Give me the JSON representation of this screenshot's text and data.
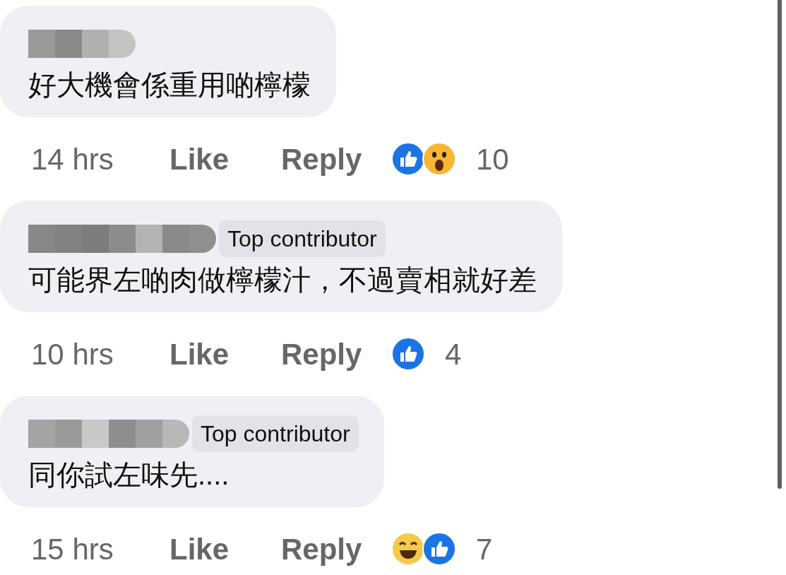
{
  "comments": [
    {
      "text": "好大機會係重用啲檸檬",
      "time": "14 hrs",
      "like": "Like",
      "reply": "Reply",
      "reactions": [
        {
          "kind": "like"
        },
        {
          "kind": "wow"
        }
      ],
      "count": "10"
    },
    {
      "text": "可能界左啲肉做檸檬汁，不過賣相就好差",
      "badge": "Top contributor",
      "time": "10 hrs",
      "like": "Like",
      "reply": "Reply",
      "reactions": [
        {
          "kind": "like"
        }
      ],
      "count": "4"
    },
    {
      "text": "同你試左味先....",
      "badge": "Top contributor",
      "time": "15 hrs",
      "like": "Like",
      "reply": "Reply",
      "reactions": [
        {
          "kind": "haha"
        },
        {
          "kind": "like"
        }
      ],
      "count": "7"
    }
  ]
}
